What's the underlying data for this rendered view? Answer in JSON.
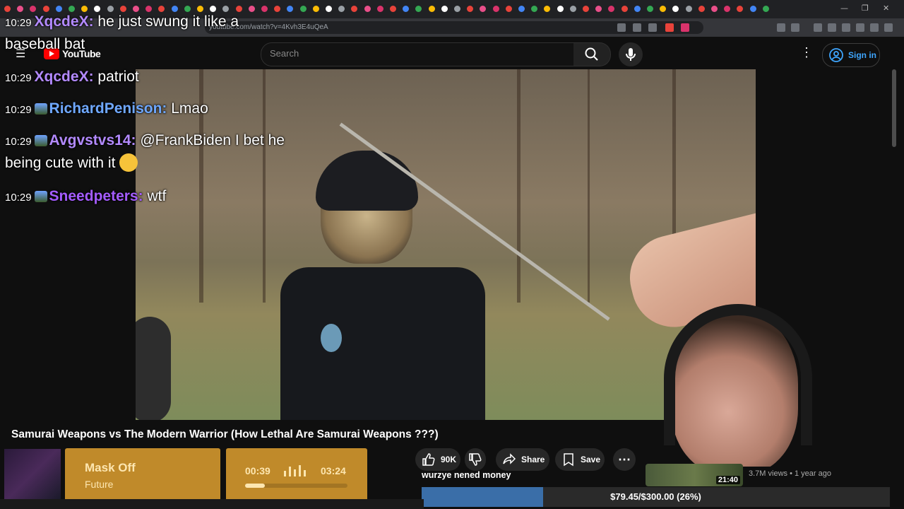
{
  "browser": {
    "url": "youtube.com/watch?v=4Kvh3E4uQeA",
    "tab_count_visible": 60
  },
  "youtube": {
    "logo_text": "YouTube",
    "search_placeholder": "Search",
    "sign_in_label": "Sign in"
  },
  "chat": {
    "messages": [
      {
        "time": "10:29",
        "user": "XqcdeX",
        "color": "#b38aff",
        "text": "he just swung it like a baseball bat"
      },
      {
        "time": "10:29",
        "user": "XqcdeX",
        "color": "#b38aff",
        "text": "patriot"
      },
      {
        "time": "10:29",
        "user": "RichardPenison",
        "color": "#6fa8ff",
        "text": "Lmao"
      },
      {
        "time": "10:29",
        "user": "Avgvstvs14",
        "color": "#b38aff",
        "text": "@FrankBiden I bet he being cute with it"
      },
      {
        "time": "10:29",
        "user": "Sneedpeters",
        "color": "#a45cff",
        "text": "wtf"
      }
    ]
  },
  "video": {
    "title": "Samurai Weapons vs The Modern Warrior (How Lethal Are Samurai Weapons ???)"
  },
  "actions": {
    "likes": "90K",
    "share_label": "Share",
    "save_label": "Save"
  },
  "song": {
    "title": "Mask Off",
    "artist": "Future",
    "current_time": "00:39",
    "total_time": "03:24",
    "progress": 0.19
  },
  "donation": {
    "message": "wurzye nened money",
    "goal_text": "$79.45/$300.00 (26%)",
    "progress": 0.26
  },
  "recommended": {
    "duration": "21:40",
    "meta": "3.7M views • 1 year ago"
  },
  "colors": {
    "accent": "#3ea6ff",
    "song_card": "#c08a2a",
    "goal_fill": "#3a6ea8"
  }
}
